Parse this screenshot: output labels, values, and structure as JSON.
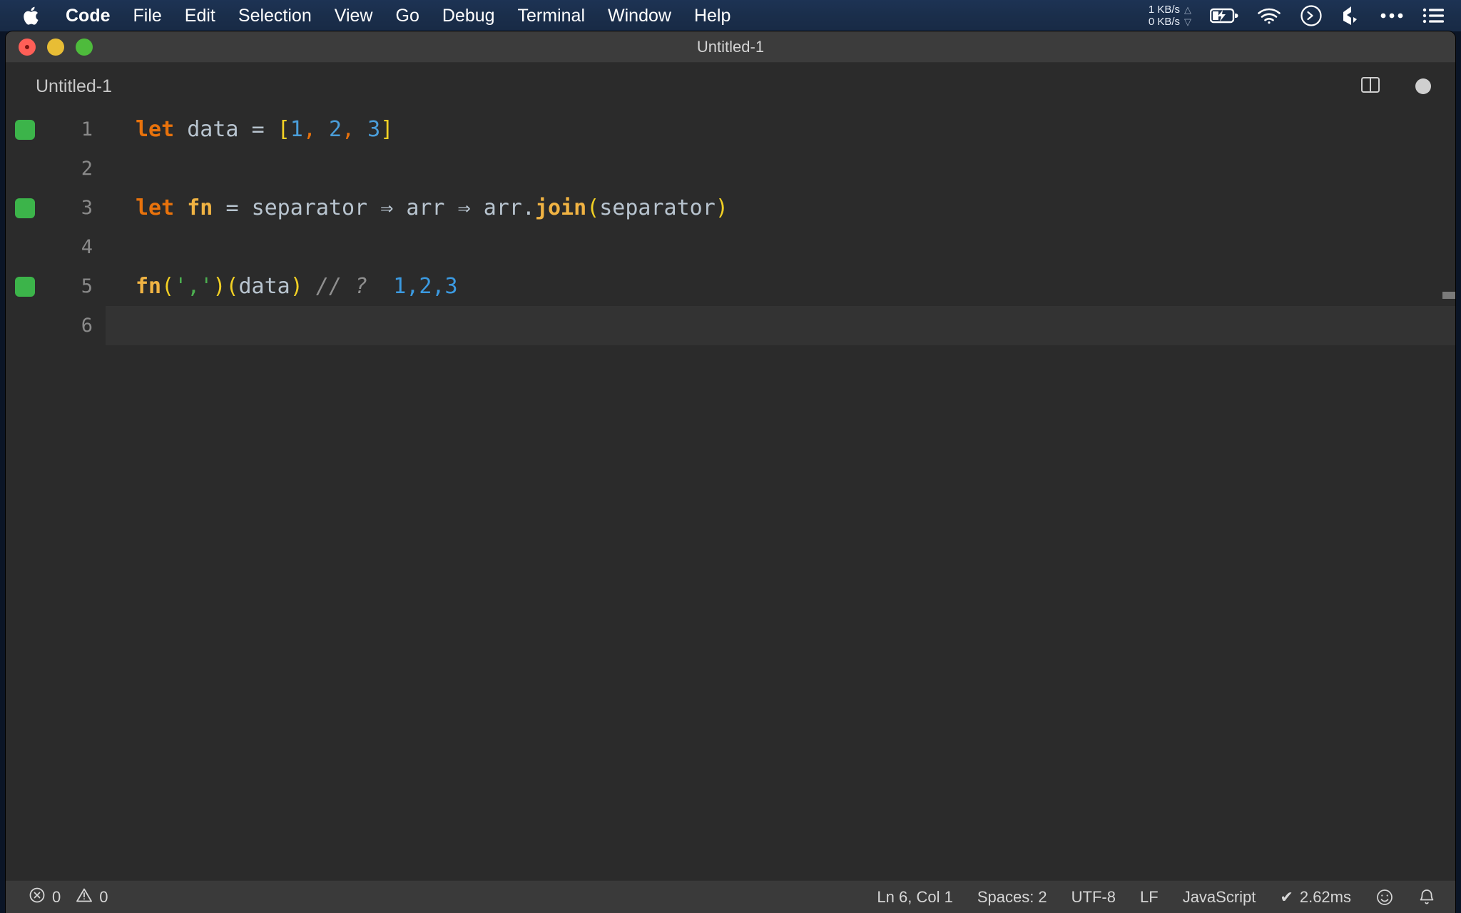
{
  "menubar": {
    "apple_icon": "apple-logo-icon",
    "items": [
      {
        "label": "Code",
        "bold": true
      },
      {
        "label": "File",
        "bold": false
      },
      {
        "label": "Edit",
        "bold": false
      },
      {
        "label": "Selection",
        "bold": false
      },
      {
        "label": "View",
        "bold": false
      },
      {
        "label": "Go",
        "bold": false
      },
      {
        "label": "Debug",
        "bold": false
      },
      {
        "label": "Terminal",
        "bold": false
      },
      {
        "label": "Window",
        "bold": false
      },
      {
        "label": "Help",
        "bold": false
      }
    ],
    "network": {
      "up": "1 KB/s",
      "down": "0 KB/s",
      "up_arrow": "△",
      "down_arrow": "▽"
    },
    "icons": [
      "battery-charging-icon",
      "wifi-icon",
      "terminal-circle-icon",
      "dropbox-icon",
      "ellipsis-icon",
      "list-menu-icon"
    ]
  },
  "window": {
    "title": "Untitled-1",
    "traffic_lights": [
      "close-button",
      "minimize-button",
      "maximize-button"
    ]
  },
  "tab": {
    "label": "Untitled-1",
    "split_icon": "split-editor-icon",
    "dirty_indicator": "unsaved-dot-icon"
  },
  "editor": {
    "language": "JavaScript",
    "lines": [
      {
        "number": "1",
        "has_marker": true,
        "current": false,
        "tokens": [
          {
            "t": "let",
            "c": "kw"
          },
          {
            "t": " ",
            "c": "op"
          },
          {
            "t": "data",
            "c": "var"
          },
          {
            "t": " ",
            "c": "op"
          },
          {
            "t": "=",
            "c": "op"
          },
          {
            "t": " ",
            "c": "op"
          },
          {
            "t": "[",
            "c": "brk"
          },
          {
            "t": "1",
            "c": "num"
          },
          {
            "t": ",",
            "c": "comma"
          },
          {
            "t": " ",
            "c": "op"
          },
          {
            "t": "2",
            "c": "num"
          },
          {
            "t": ",",
            "c": "comma"
          },
          {
            "t": " ",
            "c": "op"
          },
          {
            "t": "3",
            "c": "num"
          },
          {
            "t": "]",
            "c": "brk"
          }
        ]
      },
      {
        "number": "2",
        "has_marker": false,
        "current": false,
        "tokens": []
      },
      {
        "number": "3",
        "has_marker": true,
        "current": false,
        "tokens": [
          {
            "t": "let",
            "c": "kw"
          },
          {
            "t": " ",
            "c": "op"
          },
          {
            "t": "fn",
            "c": "fn"
          },
          {
            "t": " ",
            "c": "op"
          },
          {
            "t": "=",
            "c": "op"
          },
          {
            "t": " ",
            "c": "op"
          },
          {
            "t": "separator",
            "c": "var"
          },
          {
            "t": " ",
            "c": "op"
          },
          {
            "t": "⇒",
            "c": "arrow"
          },
          {
            "t": " ",
            "c": "op"
          },
          {
            "t": "arr",
            "c": "var"
          },
          {
            "t": " ",
            "c": "op"
          },
          {
            "t": "⇒",
            "c": "arrow"
          },
          {
            "t": " ",
            "c": "op"
          },
          {
            "t": "arr",
            "c": "var"
          },
          {
            "t": ".",
            "c": "var"
          },
          {
            "t": "join",
            "c": "fn"
          },
          {
            "t": "(",
            "c": "brk"
          },
          {
            "t": "separator",
            "c": "var"
          },
          {
            "t": ")",
            "c": "brk"
          }
        ]
      },
      {
        "number": "4",
        "has_marker": false,
        "current": false,
        "tokens": []
      },
      {
        "number": "5",
        "has_marker": true,
        "current": false,
        "tokens": [
          {
            "t": "fn",
            "c": "fn"
          },
          {
            "t": "(",
            "c": "brk"
          },
          {
            "t": "','",
            "c": "str"
          },
          {
            "t": ")",
            "c": "brk"
          },
          {
            "t": "(",
            "c": "brk"
          },
          {
            "t": "data",
            "c": "var"
          },
          {
            "t": ")",
            "c": "brk"
          },
          {
            "t": " ",
            "c": "op"
          },
          {
            "t": "//",
            "c": "cmt"
          },
          {
            "t": " ",
            "c": "op"
          },
          {
            "t": "?",
            "c": "cmt"
          },
          {
            "t": "  ",
            "c": "op"
          },
          {
            "t": "1,2,3",
            "c": "res"
          }
        ]
      },
      {
        "number": "6",
        "has_marker": false,
        "current": true,
        "tokens": []
      }
    ]
  },
  "statusbar": {
    "errors_icon": "error-circle-icon",
    "errors": "0",
    "warnings_icon": "warning-triangle-icon",
    "warnings": "0",
    "position": "Ln 6, Col 1",
    "indentation": "Spaces: 2",
    "encoding": "UTF-8",
    "eol": "LF",
    "language": "JavaScript",
    "run_status": "2.62ms",
    "run_check": "✔",
    "feedback_icon": "smiley-icon",
    "notifications_icon": "bell-icon"
  },
  "colors": {
    "menubar_bg": "#1d3354",
    "editor_bg": "#2b2b2b",
    "titlebar_bg": "#3c3c3c",
    "statusbar_bg": "#3a3a3a",
    "marker_green": "#3cb44a",
    "keyword_orange": "#e8720c",
    "bracket_yellow": "#f2d024",
    "number_blue": "#4a9eda",
    "string_green": "#4caf50",
    "function_gold": "#f0b343"
  }
}
